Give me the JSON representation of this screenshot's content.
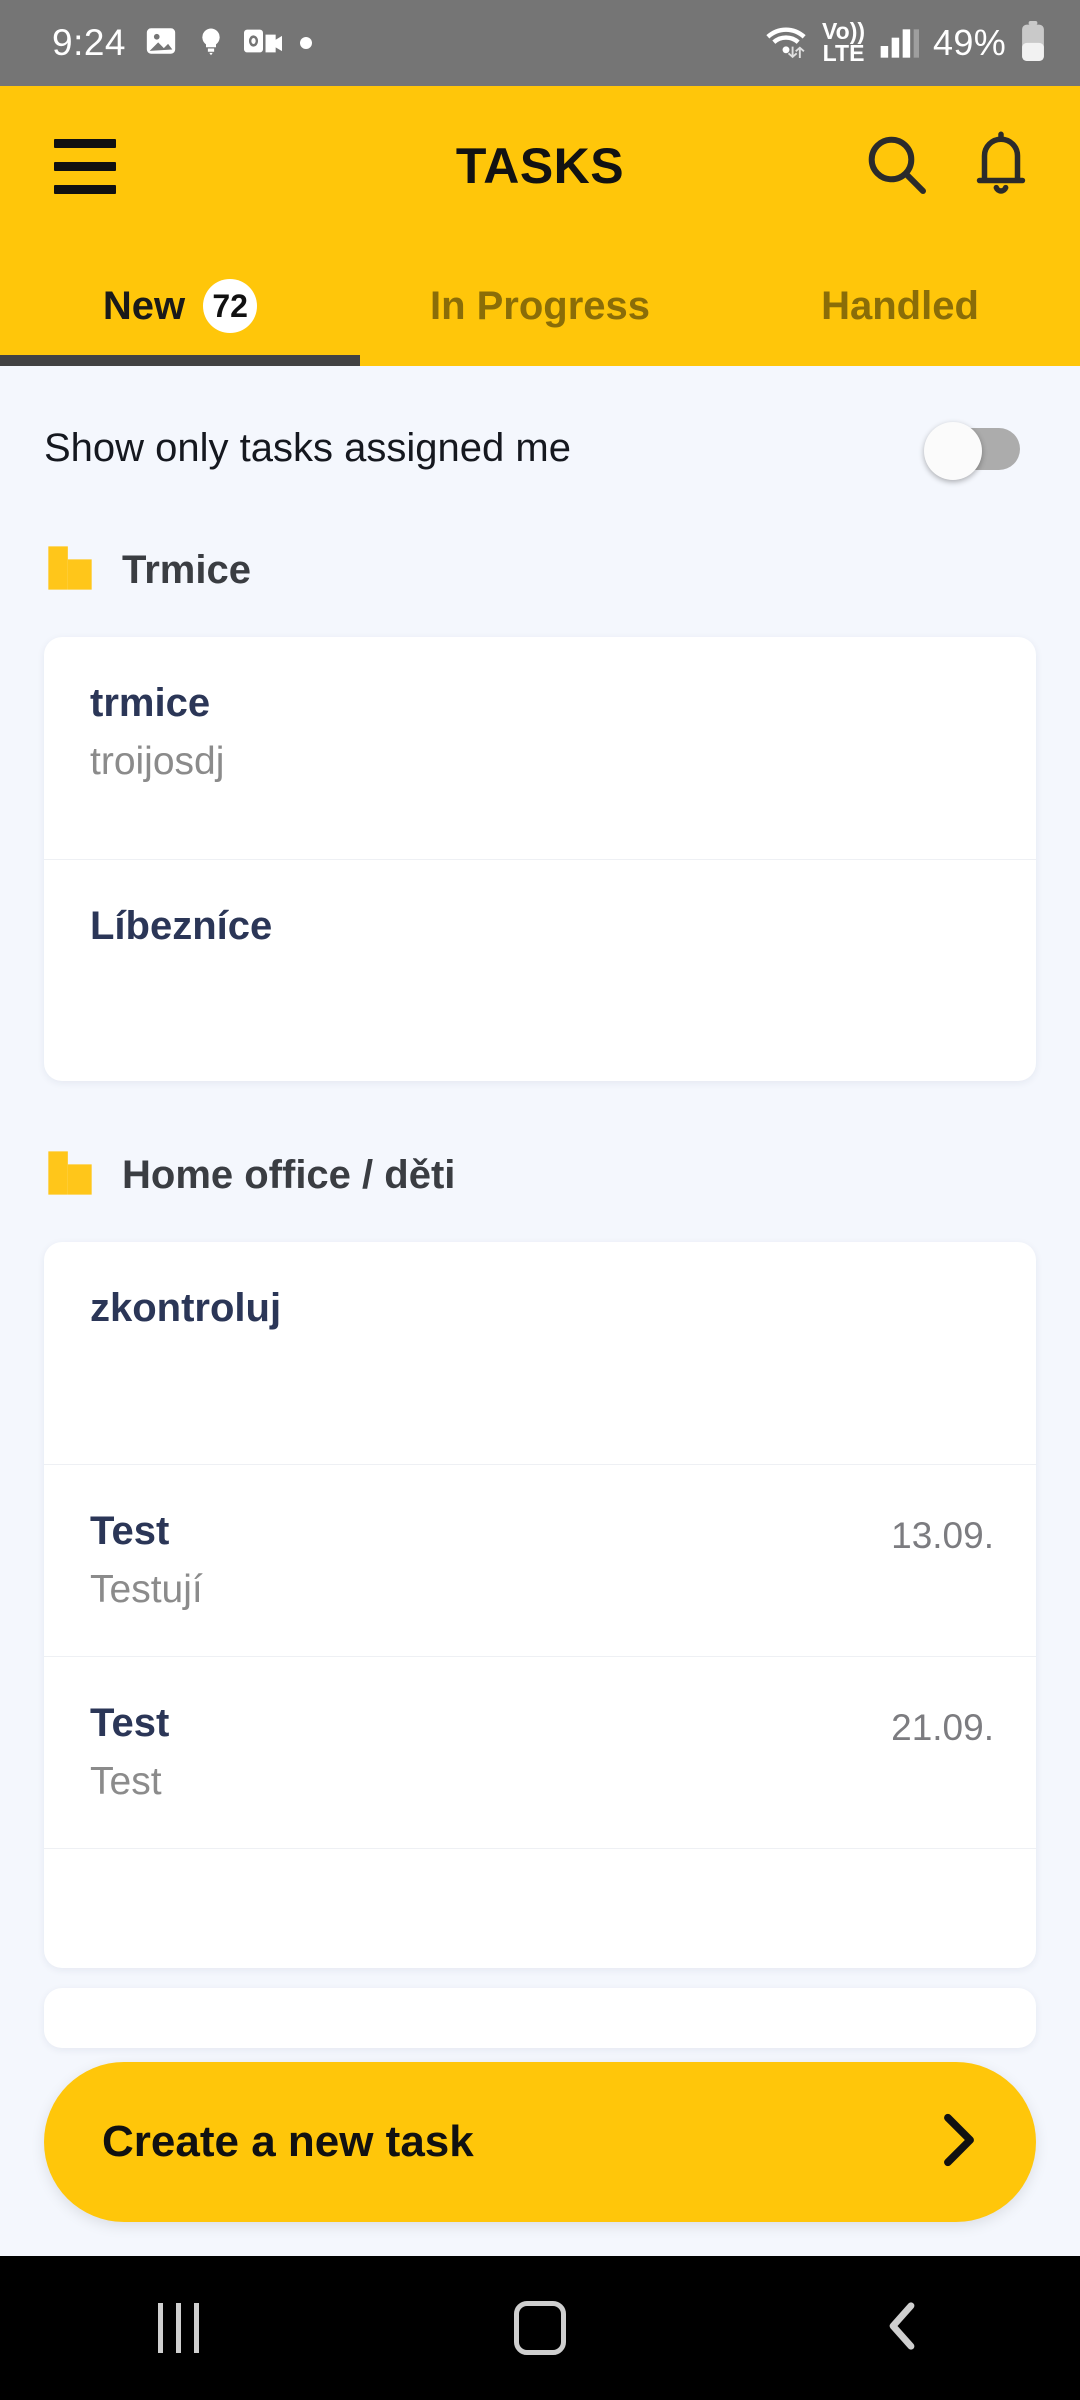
{
  "statusbar": {
    "time": "9:24",
    "left_icons": [
      "image-icon",
      "lightbulb-icon",
      "outlook-icon",
      "dot-icon"
    ],
    "wifi_icon": "wifi-icon",
    "volte_line1": "Vo))",
    "volte_line2": "LTE",
    "signal_icon": "signal-bars-icon",
    "battery_percent": "49%",
    "battery_icon": "battery-icon"
  },
  "appbar": {
    "menu_icon": "hamburger-menu-icon",
    "title": "TASKS",
    "search_icon": "search-icon",
    "notifications_icon": "bell-icon",
    "background_color": "#FFC60A"
  },
  "tabs": {
    "items": [
      {
        "label": "New",
        "badge": "72",
        "active": true
      },
      {
        "label": "In Progress",
        "badge": "",
        "active": false
      },
      {
        "label": "Handled",
        "badge": "",
        "active": false
      }
    ],
    "indicator_color": "#424242",
    "active_text_color": "#1A1A1A",
    "inactive_text_color": "#8A6D08"
  },
  "filter": {
    "label": "Show only tasks assigned me",
    "toggle_state": "off"
  },
  "groups": [
    {
      "icon": "building-icon",
      "title": "Trmice",
      "tasks": [
        {
          "title": "trmice",
          "subtitle": "troijosdj",
          "date": ""
        },
        {
          "title": "Líbezníce",
          "subtitle": "",
          "date": ""
        }
      ]
    },
    {
      "icon": "building-icon",
      "title": "Home office / děti",
      "tasks": [
        {
          "title": "zkontroluj",
          "subtitle": "",
          "date": ""
        },
        {
          "title": "Test",
          "subtitle": "Testují",
          "date": "13.09."
        },
        {
          "title": "Test",
          "subtitle": "Test",
          "date": "21.09."
        }
      ]
    }
  ],
  "create_button": {
    "label": "Create a new task",
    "chevron_icon": "chevron-right-icon",
    "color": "#FFC60A"
  },
  "navbar": {
    "recents_icon": "recents-icon",
    "home_icon": "home-icon",
    "back_icon": "back-chevron-icon"
  }
}
